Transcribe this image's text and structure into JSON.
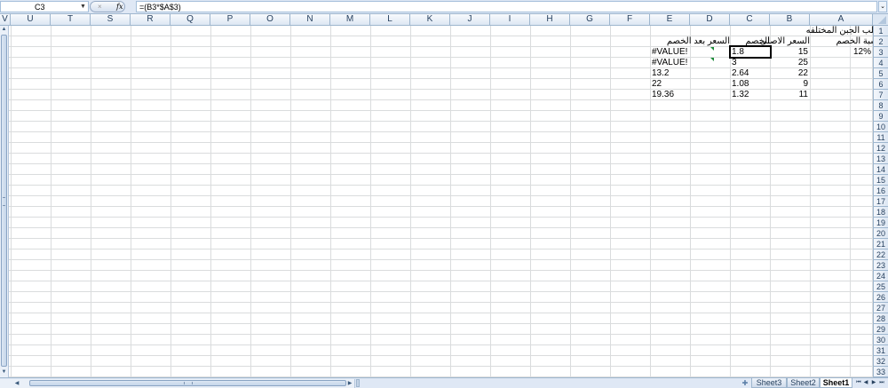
{
  "formula_bar": {
    "name_box": "C3",
    "fx_label": "fx",
    "cancel_label": "×",
    "formula": "=(B3*$A$3)",
    "expand_icon": "chevron-down-icon"
  },
  "columns": [
    "V",
    "U",
    "T",
    "S",
    "R",
    "Q",
    "P",
    "O",
    "N",
    "M",
    "L",
    "K",
    "J",
    "I",
    "H",
    "G",
    "F",
    "E",
    "D",
    "C",
    "B",
    "A"
  ],
  "rows": [
    "1",
    "2",
    "3",
    "4",
    "5",
    "6",
    "7",
    "8",
    "9",
    "10",
    "11",
    "12",
    "13",
    "14",
    "15",
    "16",
    "17",
    "18",
    "19",
    "20",
    "21",
    "22",
    "23",
    "24",
    "25",
    "26",
    "27",
    "28",
    "29",
    "30",
    "31",
    "32",
    "33"
  ],
  "cells": {
    "B1": "علب الجبن المختلفه",
    "A2": "نسبة الخصم",
    "B2": "السعر الاصلى",
    "C2": "الخصم",
    "D2": "السعر بعد الخصم",
    "A3": "12%",
    "B3": "15",
    "C3": "1.8",
    "E3": "#VALUE!",
    "B4": "25",
    "C4": "3",
    "E4": "#VALUE!",
    "B5": "22",
    "C5": "2.64",
    "E5": "13.2",
    "B6": "9",
    "C6": "1.08",
    "E6": "22",
    "B7": "11",
    "C7": "1.32",
    "E7": "19.36"
  },
  "sheet_tabs": [
    {
      "name": "Sheet3",
      "active": false
    },
    {
      "name": "Sheet2",
      "active": false
    },
    {
      "name": "Sheet1",
      "active": true
    }
  ],
  "colors": {
    "header_bg": "#dde7f3",
    "gridline": "#dadcdd",
    "error_indicator": "#1e8c3a"
  }
}
